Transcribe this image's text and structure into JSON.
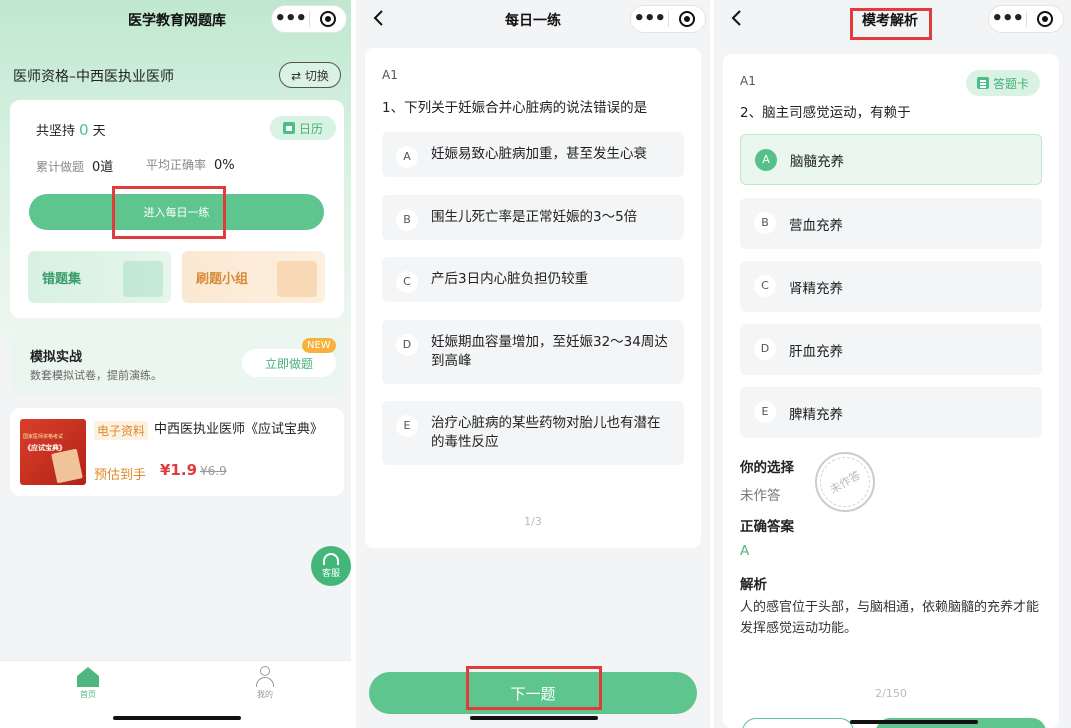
{
  "panel1": {
    "nav_title": "医学教育网题库",
    "subtitle": "医师资格–中西医执业医师",
    "switch_label": "⇄ 切换",
    "streak_prefix": "共坚持",
    "streak_value": "0",
    "streak_suffix": "天",
    "calendar_label": "日历",
    "stats": [
      {
        "label": "累计做题",
        "value": "0道"
      },
      {
        "label": "平均正确率",
        "value": "0%"
      }
    ],
    "enter_label": "进入每日一练",
    "tile_wrong": "错题集",
    "tile_group": "刷题小组",
    "sim_title": "模拟实战",
    "sim_desc": "数套模拟试卷，提前演练。",
    "sim_button": "立即做题",
    "new_badge": "NEW",
    "book_line1": "国家医师资格考试",
    "book_line2": "《应试宝典》",
    "product_tag": "电子资料",
    "product_title": "中西医执业医师《应试宝典》",
    "price_prefix": "预估到手",
    "price_now": "¥1.9",
    "price_old": "¥6.9",
    "service_label": "客服",
    "tabs": [
      {
        "label": "首页"
      },
      {
        "label": "我的"
      }
    ]
  },
  "panel2": {
    "nav_title": "每日一练",
    "q_type": "A1",
    "question": "1、下列关于妊娠合并心脏病的说法错误的是",
    "options": [
      {
        "letter": "A",
        "text": "妊娠易致心脏病加重，甚至发生心衰"
      },
      {
        "letter": "B",
        "text": "围生儿死亡率是正常妊娠的3～5倍"
      },
      {
        "letter": "C",
        "text": "产后3日内心脏负担仍较重"
      },
      {
        "letter": "D",
        "text": "妊娠期血容量增加，至妊娠32～34周达到高峰"
      },
      {
        "letter": "E",
        "text": "治疗心脏病的某些药物对胎儿也有潜在的毒性反应"
      }
    ],
    "pager": "1/3",
    "next_label": "下一题"
  },
  "panel3": {
    "nav_title": "模考解析",
    "q_type": "A1",
    "sheet_label": "答题卡",
    "question": "2、脑主司感觉运动，有赖于",
    "options": [
      {
        "letter": "A",
        "text": "脑髓充养"
      },
      {
        "letter": "B",
        "text": "营血充养"
      },
      {
        "letter": "C",
        "text": "肾精充养"
      },
      {
        "letter": "D",
        "text": "肝血充养"
      },
      {
        "letter": "E",
        "text": "脾精充养"
      }
    ],
    "your_choice_label": "你的选择",
    "your_choice_value": "未作答",
    "stamp_text": "未作答",
    "correct_label": "正确答案",
    "correct_value": "A",
    "analysis_label": "解析",
    "analysis_text": "人的感官位于头部，与脑相通，依赖脑髓的充养才能发挥感觉运动功能。",
    "pager": "2/150"
  },
  "colors": {
    "accent": "#5ec58f",
    "highlight_box": "#e23b3b",
    "price": "#e23b3b",
    "tag": "#e0892a"
  }
}
